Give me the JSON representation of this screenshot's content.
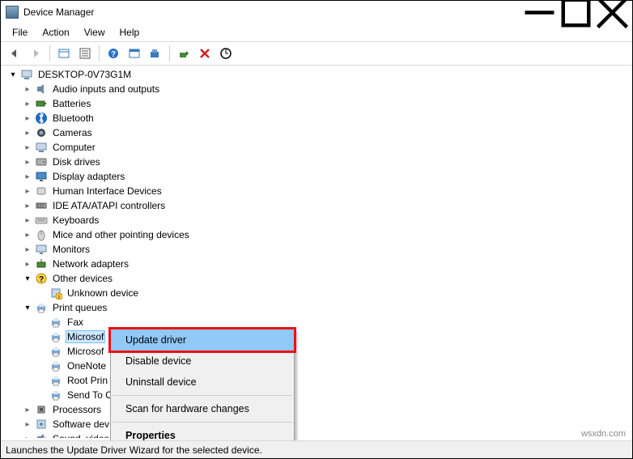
{
  "window": {
    "title": "Device Manager"
  },
  "menu": {
    "file": "File",
    "action": "Action",
    "view": "View",
    "help": "Help"
  },
  "root": "DESKTOP-0V73G1M",
  "categories": [
    {
      "label": "Audio inputs and outputs",
      "icon": "speaker"
    },
    {
      "label": "Batteries",
      "icon": "battery"
    },
    {
      "label": "Bluetooth",
      "icon": "bluetooth"
    },
    {
      "label": "Cameras",
      "icon": "camera"
    },
    {
      "label": "Computer",
      "icon": "computer"
    },
    {
      "label": "Disk drives",
      "icon": "disk"
    },
    {
      "label": "Display adapters",
      "icon": "display"
    },
    {
      "label": "Human Interface Devices",
      "icon": "hid"
    },
    {
      "label": "IDE ATA/ATAPI controllers",
      "icon": "ide"
    },
    {
      "label": "Keyboards",
      "icon": "keyboard"
    },
    {
      "label": "Mice and other pointing devices",
      "icon": "mouse"
    },
    {
      "label": "Monitors",
      "icon": "monitor"
    },
    {
      "label": "Network adapters",
      "icon": "network"
    }
  ],
  "other_devices": {
    "label": "Other devices",
    "children": [
      {
        "label": "Unknown device",
        "icon": "unknown"
      }
    ]
  },
  "print_queues": {
    "label": "Print queues",
    "children": [
      {
        "label": "Fax"
      },
      {
        "label": "Microsof",
        "selected": true
      },
      {
        "label": "Microsof"
      },
      {
        "label": "OneNote"
      },
      {
        "label": "Root Prin"
      },
      {
        "label": "Send To C"
      }
    ]
  },
  "after": [
    {
      "label": "Processors",
      "icon": "cpu"
    },
    {
      "label": "Software dev",
      "icon": "software"
    },
    {
      "label": "Sound, video",
      "icon": "sound",
      "cut": true
    }
  ],
  "context_menu": {
    "update": "Update driver",
    "disable": "Disable device",
    "uninstall": "Uninstall device",
    "scan": "Scan for hardware changes",
    "properties": "Properties"
  },
  "statusbar": "Launches the Update Driver Wizard for the selected device.",
  "watermark": "wsxdn.com"
}
